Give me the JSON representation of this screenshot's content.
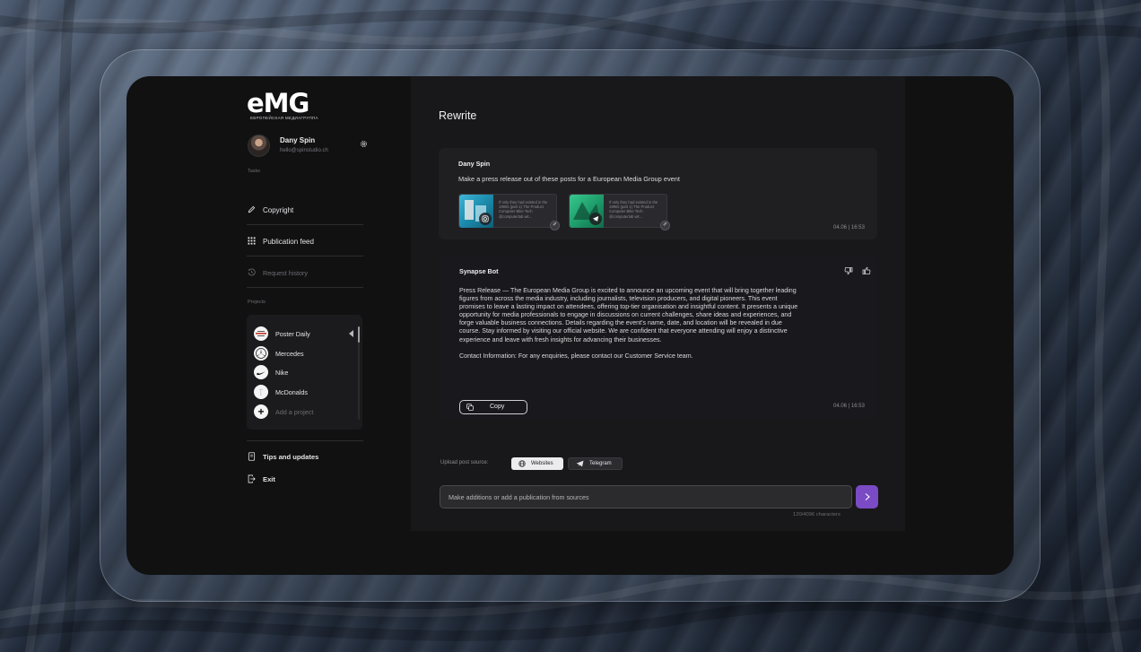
{
  "brand": {
    "logo": "eMG",
    "tagline": "ЕВРОПЕЙСКАЯ МЕДИАГРУППА"
  },
  "profile": {
    "name": "Dany Spin",
    "email": "hello@spinstudio.ch"
  },
  "sidebar": {
    "tasks_label": "Tasks",
    "items": [
      {
        "label": "Copyright",
        "icon": "pencil-icon"
      },
      {
        "label": "Publication feed",
        "icon": "grid-icon"
      },
      {
        "label": "Request history",
        "icon": "history-icon"
      }
    ],
    "projects_label": "Projects",
    "projects": [
      {
        "name": "Poster Daily",
        "icon": "poster-daily-logo"
      },
      {
        "name": "Mercedes",
        "icon": "mercedes-logo"
      },
      {
        "name": "Nike",
        "icon": "nike-logo"
      },
      {
        "name": "McDonalds",
        "icon": "mcdonalds-logo"
      }
    ],
    "add_project": "Add a project",
    "footer": [
      {
        "label": "Tips and updates",
        "icon": "book-icon"
      },
      {
        "label": "Exit",
        "icon": "exit-icon"
      }
    ]
  },
  "main": {
    "title": "Rewrite",
    "user_message": {
      "author": "Dany Spin",
      "text": "Make a press release out of these posts for a European Media Group event",
      "attachments": [
        {
          "source": "instagram",
          "snippet": "If only they had existed in the 1990s (part 1) The Product Computer Bike Tech @computerlab wit..."
        },
        {
          "source": "telegram",
          "snippet": "If only they had existed in the 1990s (part 1) The Product Computer Bike Tech @computerlab wit..."
        }
      ],
      "date": "04.06",
      "time": "16:53"
    },
    "bot_message": {
      "author": "Synapse Bot",
      "paragraphs": [
        "Press Release — The European Media Group is excited to announce an upcoming event that will bring together leading figures from across the media industry, including journalists, television producers, and digital pioneers. This event promises to leave a lasting impact on attendees, offering top-tier organisation and insightful content. It presents a unique opportunity for media professionals to engage in discussions on current challenges, share ideas and experiences, and forge valuable business connections. Details regarding the event's name, date, and location will be revealed in due course. Stay informed by visiting our official website. We are confident that everyone attending will enjoy a distinctive experience and leave with fresh insights for advancing their businesses.",
        "Contact Information: For any enquiries, please contact our Customer Service team."
      ],
      "copy_label": "Copy",
      "date": "04.06",
      "time": "16:53"
    },
    "upload_label": "Upload post source:",
    "sources": [
      {
        "label": "Websites",
        "icon": "globe-icon"
      },
      {
        "label": "Telegram",
        "icon": "telegram-icon"
      }
    ],
    "input_placeholder": "Make additions or add a publication from sources",
    "char_counter": "120/4096 characters"
  },
  "colors": {
    "accent": "#7a4bc4",
    "screen_bg": "#111112",
    "panel_bg": "#18181a"
  }
}
